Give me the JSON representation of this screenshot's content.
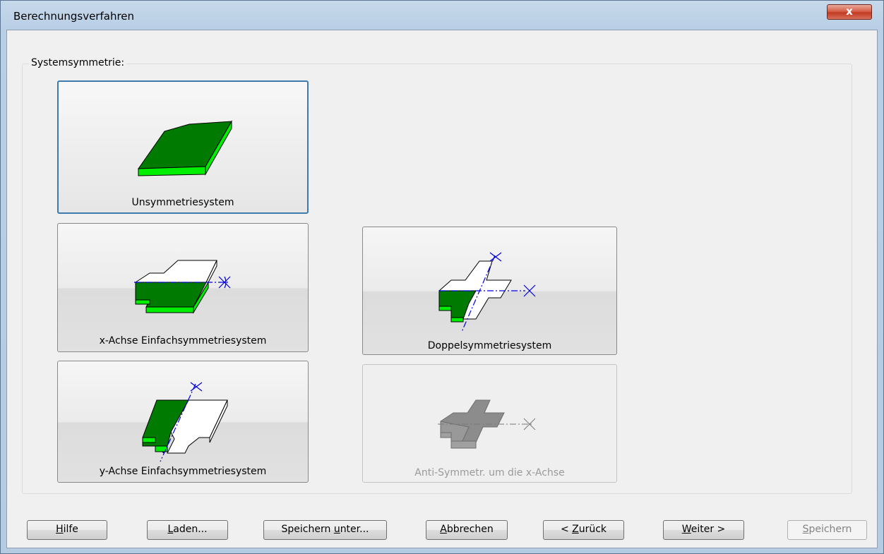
{
  "window": {
    "title": "Berechnungsverfahren",
    "close_label": "x"
  },
  "group": {
    "label": "Systemsymmetrie:"
  },
  "options": [
    {
      "id": "unsym",
      "label": "Unsymmetriesystem",
      "selected": true,
      "enabled": true
    },
    {
      "id": "xsym",
      "label": "x-Achse Einfachsymmetriesystem",
      "selected": false,
      "enabled": true
    },
    {
      "id": "doppel",
      "label": "Doppelsymmetriesystem",
      "selected": false,
      "enabled": true
    },
    {
      "id": "ysym",
      "label": "y-Achse Einfachsymmetriesystem",
      "selected": false,
      "enabled": true
    },
    {
      "id": "anti",
      "label": "Anti-Symmetr. um die x-Achse",
      "selected": false,
      "enabled": false
    }
  ],
  "buttons": [
    {
      "label": "Hilfe",
      "mnemonic": "H",
      "rest": "ilfe",
      "enabled": true
    },
    {
      "label": "Laden...",
      "mnemonic": "L",
      "rest": "aden...",
      "enabled": true
    },
    {
      "label": "Speichern unter...",
      "pre": "Speichern ",
      "mnemonic": "u",
      "rest": "nter...",
      "enabled": true
    },
    {
      "label": "Abbrechen",
      "mnemonic": "A",
      "rest": "bbrechen",
      "enabled": true
    },
    {
      "label": "< Zurück",
      "pre": "< ",
      "mnemonic": "Z",
      "rest": "urück",
      "enabled": true
    },
    {
      "label": "Weiter >",
      "mnemonic": "W",
      "rest": "eiter >",
      "enabled": true
    },
    {
      "label": "Speichern",
      "mnemonic": "S",
      "rest": "peichern",
      "enabled": false
    }
  ],
  "colors": {
    "green_dark": "#007a00",
    "green_light": "#00ee00",
    "axis_blue": "#0000dd",
    "disabled_gray": "#8c8c8c"
  }
}
